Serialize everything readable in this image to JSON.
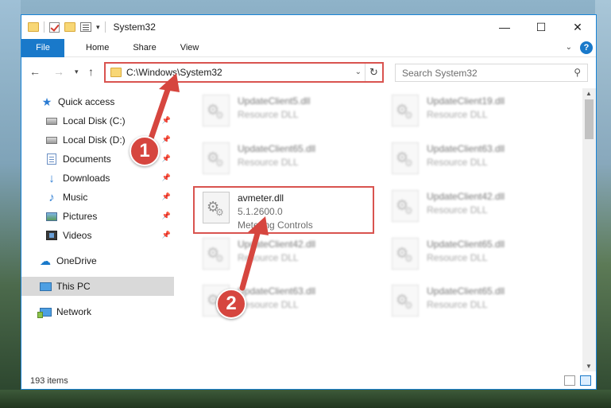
{
  "window": {
    "title": "System32",
    "controls": {
      "minimize": "—",
      "maximize": "☐",
      "close": "✕"
    }
  },
  "ribbon": {
    "tabs": [
      "File",
      "Home",
      "Share",
      "View"
    ],
    "help": "?"
  },
  "address": {
    "path": "C:\\Windows\\System32",
    "search_placeholder": "Search System32"
  },
  "nav": {
    "items": [
      {
        "label": "Quick access",
        "icon": "star-icon",
        "pinned": false
      },
      {
        "label": "Local Disk (C:)",
        "icon": "drive-icon",
        "pinned": true
      },
      {
        "label": "Local Disk (D:)",
        "icon": "drive-icon",
        "pinned": true
      },
      {
        "label": "Documents",
        "icon": "documents-icon",
        "pinned": true
      },
      {
        "label": "Downloads",
        "icon": "download-icon",
        "pinned": true
      },
      {
        "label": "Music",
        "icon": "music-icon",
        "pinned": true
      },
      {
        "label": "Pictures",
        "icon": "pictures-icon",
        "pinned": true
      },
      {
        "label": "Videos",
        "icon": "videos-icon",
        "pinned": true
      },
      {
        "label": "OneDrive",
        "icon": "cloud-icon",
        "pinned": false
      },
      {
        "label": "This PC",
        "icon": "computer-icon",
        "pinned": false,
        "selected": true
      },
      {
        "label": "Network",
        "icon": "network-icon",
        "pinned": false
      }
    ]
  },
  "files": {
    "left": [
      {
        "name": "UpdateClient5.dll",
        "line2": "Resource DLL",
        "line3": ""
      },
      {
        "name": "UpdateClient65.dll",
        "line2": "Resource DLL",
        "line3": ""
      },
      {
        "name": "avmeter.dll",
        "line2": "5.1.2600.0",
        "line3": "Metering Controls"
      },
      {
        "name": "UpdateClient42.dll",
        "line2": "Resource DLL",
        "line3": ""
      },
      {
        "name": "UpdateClient63.dll",
        "line2": "Resource DLL",
        "line3": ""
      }
    ],
    "right": [
      {
        "name": "UpdateClient19.dll",
        "line2": "Resource DLL"
      },
      {
        "name": "UpdateClient63.dll",
        "line2": "Resource DLL"
      },
      {
        "name": "UpdateClient42.dll",
        "line2": "Resource DLL"
      },
      {
        "name": "UpdateClient65.dll",
        "line2": "Resource DLL"
      },
      {
        "name": "UpdateClient65.dll",
        "line2": "Resource DLL"
      }
    ]
  },
  "status": {
    "item_count": "193 items"
  },
  "annotations": {
    "step1": "1",
    "step2": "2",
    "color": "#d6463f"
  }
}
